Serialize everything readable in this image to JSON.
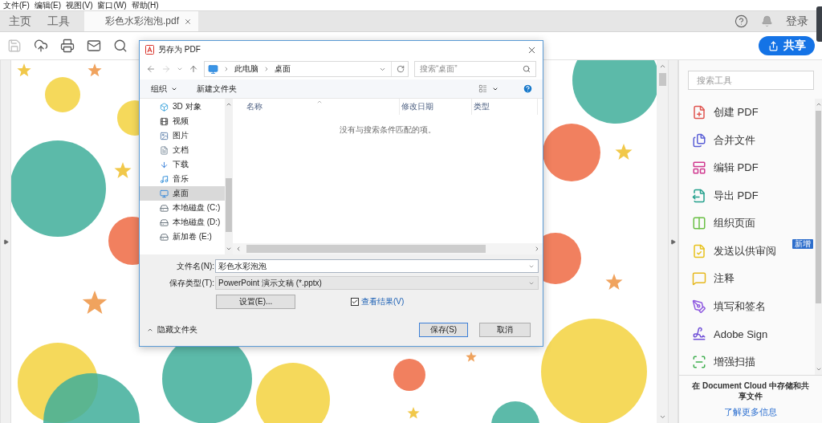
{
  "menu": [
    "文件(F)",
    "编辑(E)",
    "视图(V)",
    "窗口(W)",
    "帮助(H)"
  ],
  "tabs": [
    {
      "label": "主页",
      "kind": "nav",
      "selected": false
    },
    {
      "label": "工具",
      "kind": "nav",
      "selected": false
    },
    {
      "label": "彩色水彩泡泡.pdf",
      "kind": "document",
      "selected": true
    }
  ],
  "account": {
    "login": "登录"
  },
  "toolbar": [
    {
      "disabled": true
    },
    {
      "disabled": false
    },
    {
      "disabled": false
    },
    {
      "disabled": false
    },
    {
      "disabled": false
    }
  ],
  "share_button": {
    "label": "共享"
  },
  "dialog": {
    "title": "另存为 PDF",
    "path": [
      "此电脑",
      "桌面"
    ],
    "search": {
      "placeholder": "搜索“桌面”"
    },
    "commands": [
      {
        "label": "组织",
        "dropdown": true
      },
      {
        "label": "新建文件夹",
        "dropdown": false
      }
    ],
    "nav": [
      {
        "label": "3D 对象",
        "selected": false
      },
      {
        "label": "视频",
        "selected": false
      },
      {
        "label": "图片",
        "selected": false
      },
      {
        "label": "文档",
        "selected": false
      },
      {
        "label": "下载",
        "selected": false
      },
      {
        "label": "音乐",
        "selected": false
      },
      {
        "label": "桌面",
        "selected": true
      },
      {
        "label": "本地磁盘 (C:)",
        "selected": false
      },
      {
        "label": "本地磁盘 (D:)",
        "selected": false
      },
      {
        "label": "新加卷 (E:)",
        "selected": false
      }
    ],
    "columns": [
      "名称",
      "修改日期",
      "类型"
    ],
    "empty_message": "没有与搜索条件匹配的项。",
    "fields": [
      {
        "label": "文件名(N):",
        "value": "彩色水彩泡泡",
        "kind": "input"
      },
      {
        "label": "保存类型(T):",
        "value": "PowerPoint 演示文稿 (*.pptx)",
        "kind": "select"
      }
    ],
    "settings_button": "设置(E)...",
    "view_result": {
      "label": "查看结果(V)",
      "checked": true
    },
    "hide_folders": "隐藏文件夹",
    "buttons": [
      {
        "label": "保存(S)",
        "default": true
      },
      {
        "label": "取消",
        "default": false
      }
    ]
  },
  "tools_panel": {
    "search": {
      "placeholder": "搜索工具"
    },
    "tools": [
      {
        "label": "创建 PDF",
        "color": "#e0544f"
      },
      {
        "label": "合并文件",
        "color": "#5a5fd6"
      },
      {
        "label": "编辑 PDF",
        "color": "#d0398f"
      },
      {
        "label": "导出 PDF",
        "color": "#23a08c"
      },
      {
        "label": "组织页面",
        "color": "#6abf45"
      },
      {
        "label": "发送以供审阅",
        "color": "#e8c11a",
        "badge": "新增"
      },
      {
        "label": "注释",
        "color": "#e6b81e"
      },
      {
        "label": "填写和签名",
        "color": "#8f5ae0"
      },
      {
        "label": "Adobe Sign",
        "color": "#7050d8"
      },
      {
        "label": "增强扫描",
        "color": "#3fae4f"
      }
    ],
    "promo": {
      "text": "在 Document Cloud 中存储和共享文件",
      "link": "了解更多信息"
    }
  }
}
